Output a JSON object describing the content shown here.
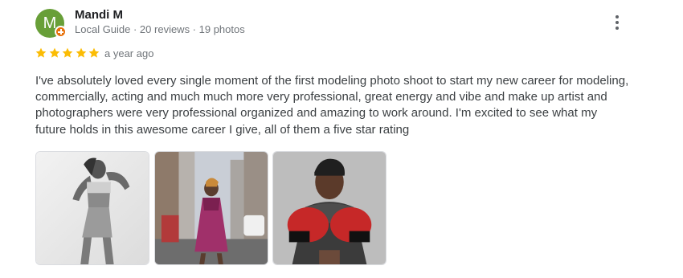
{
  "review": {
    "author": {
      "name": "Mandi M",
      "avatar_letter": "M",
      "avatar_color": "#689f38",
      "meta": "Local Guide · 20 reviews · 19 photos",
      "badge_icon": "local-guide-badge-icon",
      "badge_color": "#e8710a"
    },
    "rating": 5,
    "rating_max": 5,
    "star_color": "#fbbc04",
    "time": "a year ago",
    "text": "I've absolutely loved every single moment of the first modeling photo shoot to start my new career for modeling, commercially, acting and much much more very professional, great energy and vibe and make up artist and photographers were very professional organized and amazing to work around. I'm excited to see what my future holds in this awesome career I give, all of them a five star rating",
    "more_icon": "more-vert-icon",
    "photos": [
      {
        "style": "black-and-white studio portrait"
      },
      {
        "style": "city street fashion shot"
      },
      {
        "style": "boxing gloves portrait"
      }
    ]
  }
}
